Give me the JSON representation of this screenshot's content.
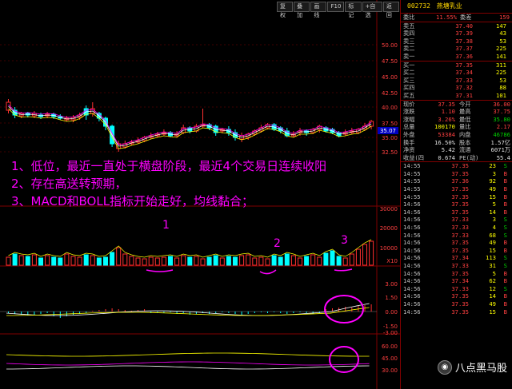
{
  "toolbar": [
    "复权",
    "叠加",
    "画线",
    "F10",
    "标记",
    "+自选",
    "返回"
  ],
  "price_scale": [
    "50.00",
    "47.50",
    "45.00",
    "42.50",
    "40.00",
    "37.50",
    "35.00",
    "32.50"
  ],
  "current_price_tag": "35.07",
  "vol_scale": [
    "30000",
    "20000",
    "10000"
  ],
  "vol_unit": "X10",
  "macd_scale": [
    "3.00",
    "1.50",
    "0.00",
    "-1.50",
    "-3.00"
  ],
  "boll_scale": [
    "60.00",
    "45.00",
    "30.00"
  ],
  "annotations": {
    "line1": "1、低位，最近一直处于横盘阶段，最近4个交易日连续收阳",
    "line2": "2、存在高送转预期，",
    "line3": "3、MACD和BOLL指标开始走好，均线黏合；"
  },
  "markers": [
    "1",
    "2",
    "3"
  ],
  "stock": {
    "code": "002732",
    "name": "燕塘乳业"
  },
  "committee": {
    "ratio_label": "委比",
    "ratio": "11.55%",
    "diff_label": "委差",
    "diff": "159"
  },
  "asks": [
    {
      "label": "卖五",
      "price": "37.40",
      "vol": "147"
    },
    {
      "label": "卖四",
      "price": "37.39",
      "vol": "43"
    },
    {
      "label": "卖三",
      "price": "37.38",
      "vol": "53"
    },
    {
      "label": "卖二",
      "price": "37.37",
      "vol": "225"
    },
    {
      "label": "卖一",
      "price": "37.36",
      "vol": "141"
    }
  ],
  "bids": [
    {
      "label": "买一",
      "price": "37.35",
      "vol": "311"
    },
    {
      "label": "买二",
      "price": "37.34",
      "vol": "225"
    },
    {
      "label": "买三",
      "price": "37.33",
      "vol": "53"
    },
    {
      "label": "买四",
      "price": "37.32",
      "vol": "88"
    },
    {
      "label": "买五",
      "price": "37.31",
      "vol": "101"
    }
  ],
  "quote": [
    {
      "l1": "现价",
      "v1": "37.35",
      "l2": "今开",
      "v2": "36.00"
    },
    {
      "l1": "涨跌",
      "v1": "1.10",
      "l2": "最高",
      "v2": "37.75"
    },
    {
      "l1": "涨幅",
      "v1": "3.26%",
      "l2": "最低",
      "v2": "35.80"
    },
    {
      "l1": "总量",
      "v1": "100170",
      "l2": "量比",
      "v2": "2.17"
    },
    {
      "l1": "外盘",
      "v1": "53384",
      "l2": "内盘",
      "v2": "46786"
    },
    {
      "l1": "换手",
      "v1": "16.50%",
      "l2": "股本",
      "v2": "1.57亿"
    },
    {
      "l1": "净资",
      "v1": "5.42",
      "l2": "流通",
      "v2": "6071万"
    },
    {
      "l1": "收益(四)",
      "v1": "0.674",
      "l2": "PE(动)",
      "v2": "55.4"
    }
  ],
  "ticks": [
    {
      "t": "14:55",
      "p": "37.35",
      "v": "23",
      "d": "S"
    },
    {
      "t": "14:55",
      "p": "37.35",
      "v": "3",
      "d": "B"
    },
    {
      "t": "14:55",
      "p": "37.36",
      "v": "92",
      "d": "B"
    },
    {
      "t": "14:55",
      "p": "37.35",
      "v": "49",
      "d": "B"
    },
    {
      "t": "14:55",
      "p": "37.35",
      "v": "15",
      "d": "B"
    },
    {
      "t": "14:56",
      "p": "37.35",
      "v": "5",
      "d": "B"
    },
    {
      "t": "14:56",
      "p": "37.35",
      "v": "14",
      "d": "B"
    },
    {
      "t": "14:56",
      "p": "37.33",
      "v": "3",
      "d": "S"
    },
    {
      "t": "14:56",
      "p": "37.33",
      "v": "4",
      "d": "S"
    },
    {
      "t": "14:56",
      "p": "37.33",
      "v": "68",
      "d": "S"
    },
    {
      "t": "14:56",
      "p": "37.35",
      "v": "49",
      "d": "B"
    },
    {
      "t": "14:56",
      "p": "37.35",
      "v": "15",
      "d": "B"
    },
    {
      "t": "14:56",
      "p": "37.34",
      "v": "113",
      "d": "S"
    },
    {
      "t": "14:56",
      "p": "37.33",
      "v": "31",
      "d": "S"
    },
    {
      "t": "14:56",
      "p": "37.35",
      "v": "5",
      "d": "B"
    },
    {
      "t": "14:56",
      "p": "37.34",
      "v": "62",
      "d": "B"
    },
    {
      "t": "14:56",
      "p": "37.33",
      "v": "12",
      "d": "S"
    },
    {
      "t": "14:56",
      "p": "37.35",
      "v": "14",
      "d": "B"
    },
    {
      "t": "14:56",
      "p": "37.35",
      "v": "49",
      "d": "B"
    },
    {
      "t": "14:56",
      "p": "37.35",
      "v": "15",
      "d": "B"
    }
  ],
  "watermark": "八点黑马股",
  "colors": {
    "up": "#ff3030",
    "down": "#00ffff",
    "grid": "#800000",
    "annotation": "#ff00ff"
  }
}
